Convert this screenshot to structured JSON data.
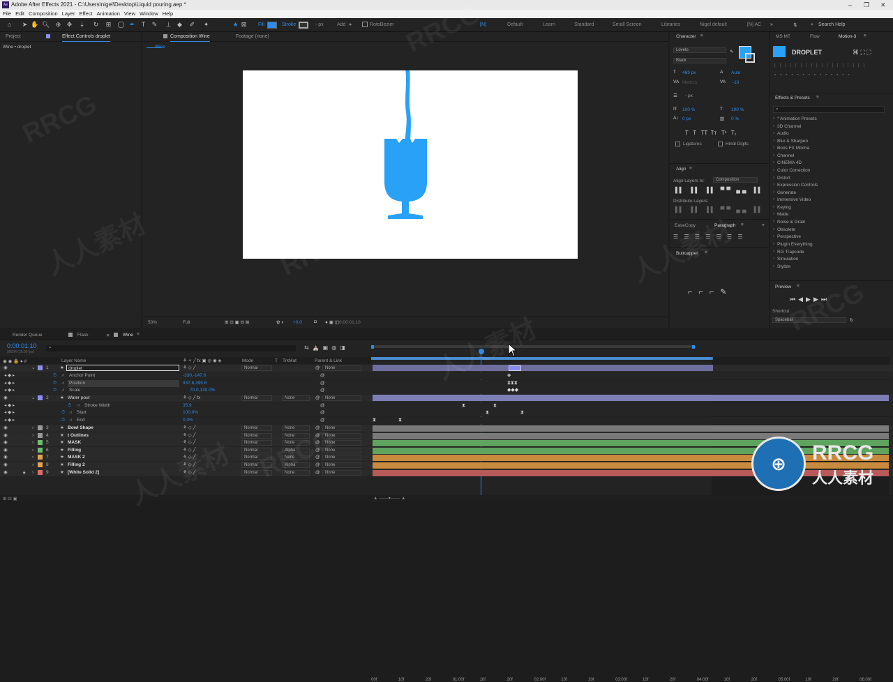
{
  "window": {
    "title": "Adobe After Effects 2021 - C:\\Users\\nigel\\Desktop\\Liquid pouring.aep *",
    "app_badge": "Ae"
  },
  "menu": [
    "File",
    "Edit",
    "Composition",
    "Layer",
    "Effect",
    "Animation",
    "View",
    "Window",
    "Help"
  ],
  "toolbar": {
    "fill_label": "Fill",
    "stroke_label": "Stroke",
    "stroke_px": "- px",
    "add_label": "Add",
    "rotobezier_label": "RotoBezier",
    "workspaces": [
      "[N]",
      "Default",
      "Learn",
      "Standard",
      "Small Screen",
      "Libraries",
      "Nigel default",
      "[N] AC"
    ],
    "search_placeholder": "Search Help"
  },
  "left_panel": {
    "tabs": [
      "Project",
      "Effect Controls droplet"
    ],
    "subtitle": "Wine • droplet"
  },
  "comp_panel": {
    "tabs": [
      "Composition Wine"
    ],
    "footage_tab": "Footage (none)",
    "comp_tab": "Wine",
    "zoom": "50%",
    "resolution": "Full",
    "exposure": "+0.0",
    "timecode": "0:00:01:10"
  },
  "character": {
    "title": "Character",
    "font": "Lovelo",
    "style": "Black",
    "size": "469 px",
    "leading": "Auto",
    "kerning": "Metrics",
    "tracking": "-10",
    "stroke_width": "- px",
    "vscale": "100 %",
    "hscale": "100 %",
    "baseline": "0 px",
    "tsume": "0 %",
    "ligatures": "Ligatures",
    "hindi": "Hindi Digits"
  },
  "align": {
    "title": "Align",
    "align_to_label": "Align Layers to:",
    "align_to": "Composition",
    "distribute": "Distribute Layers:"
  },
  "paragraph": {
    "tabs": [
      "EaseCopy",
      "Paragraph"
    ]
  },
  "buttcapper": {
    "title": "Buttcapper"
  },
  "right_panel": {
    "tabs": [
      "MS MT",
      "Flow",
      "Motion-3"
    ],
    "motion_title": "DROPLET",
    "effects_title": "Effects & Presets",
    "effects": [
      "* Animation Presets",
      "3D Channel",
      "Audio",
      "Blur & Sharpen",
      "Boris FX Mocha",
      "Channel",
      "CINEMA 4D",
      "Color Correction",
      "Distort",
      "Expression Controls",
      "Generate",
      "Immersive Video",
      "Keying",
      "Matte",
      "Noise & Grain",
      "Obsolete",
      "Perspective",
      "Plugin Everything",
      "RG Trapcode",
      "Simulation",
      "Stylize"
    ],
    "preview_title": "Preview",
    "shortcut_label": "Shortcut",
    "shortcut_value": "Spacebar"
  },
  "timeline": {
    "tabs": [
      "Render Queue",
      "Flask",
      "Wine"
    ],
    "timecode": "0:00:01:10",
    "timecode_sub": "00034 (25.00 fps)",
    "columns": {
      "name": "Layer Name",
      "mode": "Mode",
      "t": "T",
      "trkmat": "TrkMat",
      "parent": "Parent & Link"
    },
    "ruler": [
      "00f",
      "10f",
      "20f",
      "01:00f",
      "10f",
      "20f",
      "02:00f",
      "10f",
      "20f",
      "03:00f",
      "10f",
      "20f",
      "04:00f",
      "10f",
      "20f",
      "05:00f",
      "10f",
      "20f",
      "06:00f"
    ],
    "layers": [
      {
        "num": "1",
        "name": "droplet",
        "color": "#8e8ef0",
        "mode": "Normal",
        "trkmat": "",
        "parent": "None",
        "bar": "#8a8ad8"
      },
      {
        "prop": "Anchor Point",
        "value": "-330,-147.6"
      },
      {
        "prop": "Position",
        "value": "937.6,395.6"
      },
      {
        "prop": "Scale",
        "value": "70.0,130.0%"
      },
      {
        "num": "2",
        "name": "Water pour",
        "color": "#8e8ef0",
        "mode": "Normal",
        "trkmat": "None",
        "parent": "None",
        "bar": "#8a8ad8"
      },
      {
        "prop": "Stroke Width",
        "value": "35.9"
      },
      {
        "prop": "Start",
        "value": "100.0%"
      },
      {
        "prop": "End",
        "value": "0.0%"
      },
      {
        "num": "3",
        "name": "Bowl Shape",
        "color": "#9a9a9a",
        "mode": "Normal",
        "trkmat": "None",
        "parent": "None",
        "bar": "#7a7a7a"
      },
      {
        "num": "4",
        "name": "t Outlines",
        "color": "#9a9a9a",
        "mode": "Normal",
        "trkmat": "None",
        "parent": "None",
        "bar": "#7a7a7a"
      },
      {
        "num": "5",
        "name": "MASK",
        "color": "#6cbf6c",
        "mode": "Normal",
        "trkmat": "None",
        "parent": "None",
        "bar": "#5ea35e"
      },
      {
        "num": "6",
        "name": "Filling",
        "color": "#6cbf6c",
        "mode": "Normal",
        "trkmat": "Alpha",
        "parent": "None",
        "bar": "#5ea35e"
      },
      {
        "num": "7",
        "name": "MASK 2",
        "color": "#e8a24a",
        "mode": "Normal",
        "trkmat": "None",
        "parent": "None",
        "bar": "#c88a3c"
      },
      {
        "num": "8",
        "name": "Filling 2",
        "color": "#e8a24a",
        "mode": "Normal",
        "trkmat": "Alpha",
        "parent": "None",
        "bar": "#c88a3c"
      },
      {
        "num": "9",
        "name": "[White Solid 2]",
        "color": "#e06b6b",
        "mode": "Normal",
        "trkmat": "None",
        "parent": "None",
        "bar": "#b85a5a"
      }
    ]
  },
  "watermark": {
    "text1": "RRCG",
    "text2": "人人素材"
  },
  "colors": {
    "accent": "#2d8ceb",
    "glass": "#29a1f7"
  }
}
